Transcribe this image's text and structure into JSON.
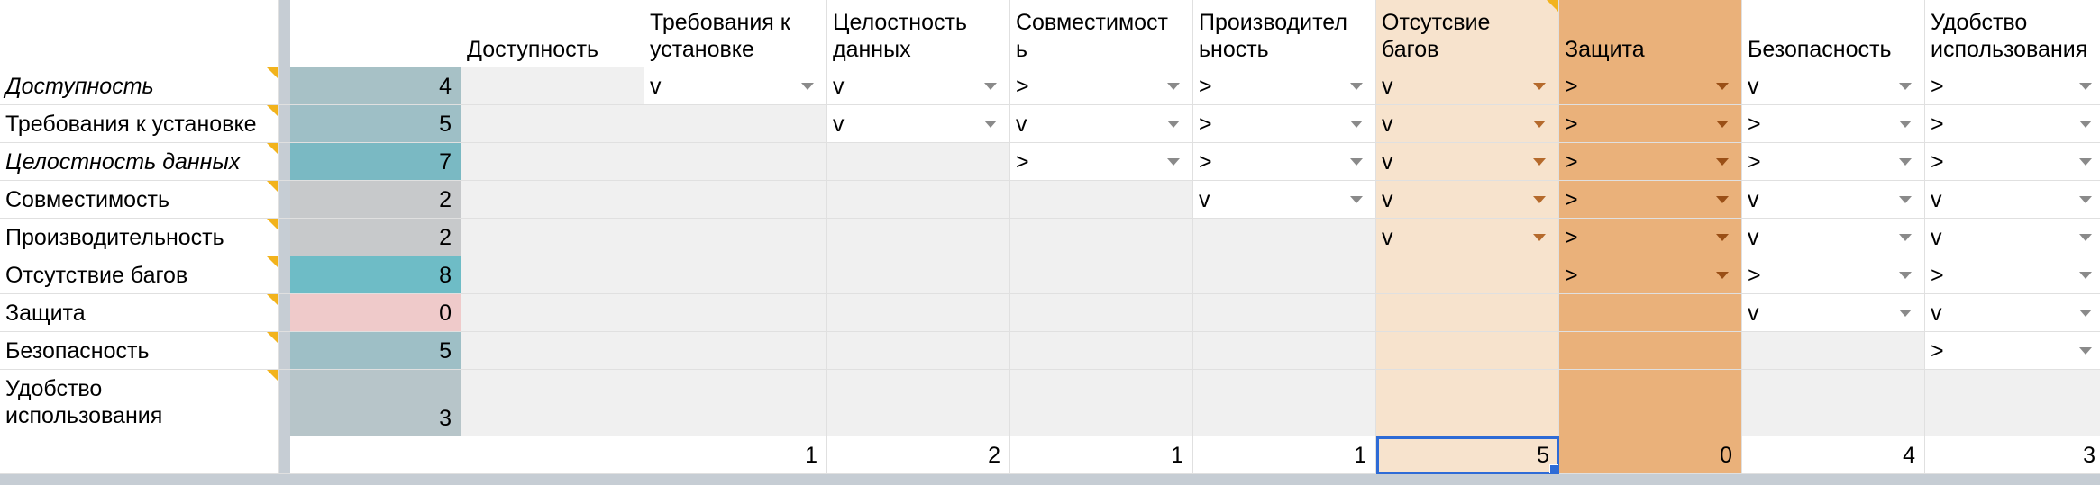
{
  "columns": [
    "Доступность",
    "Требования к установке",
    "Целостность данных",
    "Совместимость",
    "Производительность",
    "Отсутсвие багов",
    "Защита",
    "Безопасность",
    "Удобство использования"
  ],
  "headers_wrapped": [
    [
      "Доступность"
    ],
    [
      "Требования к",
      "установке"
    ],
    [
      "Целостность",
      "данных"
    ],
    [
      "Совместимост",
      "ь"
    ],
    [
      "Производител",
      "ьность"
    ],
    [
      "Отсутсвие",
      "багов"
    ],
    [
      "Защита"
    ],
    [
      "Безопасность"
    ],
    [
      "Удобство",
      "использования"
    ]
  ],
  "rows": [
    {
      "label": "Доступность",
      "italic": true,
      "count": "4",
      "count_color": "#a7c1c6",
      "cells": [
        "",
        "v",
        "v",
        ">",
        ">",
        "v",
        ">",
        "v",
        ">"
      ]
    },
    {
      "label": "Требования к установке",
      "italic": false,
      "count": "5",
      "count_color": "#9ebfc6",
      "cells": [
        "",
        "",
        "v",
        "v",
        ">",
        "v",
        ">",
        ">",
        ">"
      ]
    },
    {
      "label": "Целостность данных",
      "italic": true,
      "count": "7",
      "count_color": "#7ab9c3",
      "cells": [
        "",
        "",
        "",
        ">",
        ">",
        "v",
        ">",
        ">",
        ">"
      ]
    },
    {
      "label": "Совместимость",
      "italic": false,
      "count": "2",
      "count_color": "#c7c9cb",
      "cells": [
        "",
        "",
        "",
        "",
        "v",
        "v",
        ">",
        "v",
        "v"
      ]
    },
    {
      "label": "Производительность",
      "italic": false,
      "count": "2",
      "count_color": "#c7c9cb",
      "cells": [
        "",
        "",
        "",
        "",
        "",
        "v",
        ">",
        "v",
        "v"
      ]
    },
    {
      "label": "Отсутствие багов",
      "italic": false,
      "count": "8",
      "count_color": "#6ebcc6",
      "cells": [
        "",
        "",
        "",
        "",
        "",
        "",
        ">",
        ">",
        ">"
      ]
    },
    {
      "label": "Защита",
      "italic": false,
      "count": "0",
      "count_color": "#efcaca",
      "cells": [
        "",
        "",
        "",
        "",
        "",
        "",
        "",
        "v",
        "v"
      ]
    },
    {
      "label": "Безопасность",
      "italic": false,
      "count": "5",
      "count_color": "#9ebfc6",
      "cells": [
        "",
        "",
        "",
        "",
        "",
        "",
        "",
        "",
        ">"
      ]
    },
    {
      "label": "Удобство использования",
      "label_lines": [
        "Удобство",
        "использования"
      ],
      "italic": false,
      "count": "3",
      "count_color": "#b7c5c9",
      "cells": [
        "",
        "",
        "",
        "",
        "",
        "",
        "",
        "",
        ""
      ]
    }
  ],
  "totals": [
    "",
    "1",
    "2",
    "1",
    "1",
    "5",
    "0",
    "4",
    "3"
  ],
  "colors": {
    "highlight_column_light": "#f7e3cd",
    "highlight_column_dark": "#eab17a",
    "selection": "#2e6bd6",
    "note_marker": "#f2b31d"
  },
  "icons": {
    "dropdown": "dropdown-arrow-icon",
    "note": "note-indicator-icon"
  }
}
